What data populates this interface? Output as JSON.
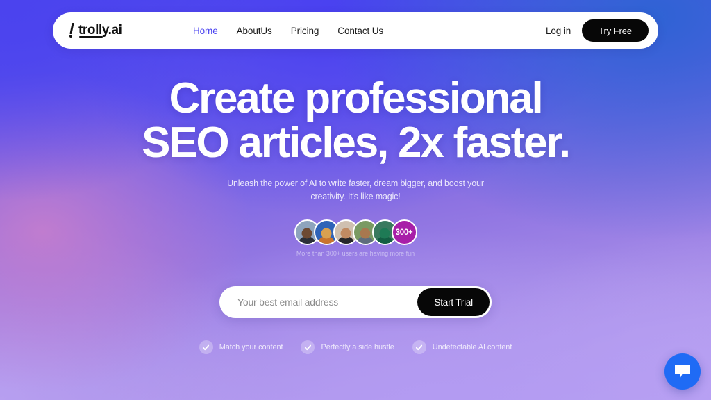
{
  "brand": {
    "logo_text": "trolly.ai",
    "logo_icon": "cart-logo-icon"
  },
  "nav": {
    "links": [
      {
        "label": "Home",
        "active": true
      },
      {
        "label": "AboutUs",
        "active": false
      },
      {
        "label": "Pricing",
        "active": false
      },
      {
        "label": "Contact Us",
        "active": false
      }
    ],
    "login_label": "Log in",
    "cta_label": "Try Free",
    "active_color": "#4a43f0"
  },
  "hero": {
    "headline_line1": "Create professional",
    "headline_line2": "SEO articles, 2x faster.",
    "subheadline": "Unleash the power of AI to write faster, dream bigger, and boost your creativity. It's like magic!"
  },
  "social_proof": {
    "avatars": [
      {
        "name": "user-avatar-1",
        "bg": "#8ea4bd",
        "face": "#6d4a33",
        "body": "#2b2f38"
      },
      {
        "name": "user-avatar-2",
        "bg": "#2e63b8",
        "face": "#d9a050",
        "body": "#c9742e"
      },
      {
        "name": "user-avatar-3",
        "bg": "#cfc0b0",
        "face": "#c08a62",
        "body": "#26262a"
      },
      {
        "name": "user-avatar-4",
        "bg": "#7a9a63",
        "face": "#a8784f",
        "body": "#5e6d7d"
      },
      {
        "name": "user-avatar-5",
        "bg": "#3a7a5e",
        "face": "#1e7a55",
        "body": "#135e43"
      }
    ],
    "count_badge": "300+",
    "count_badge_color": "#a81fa8",
    "caption": "More than 300+ users are having more fun"
  },
  "signup_form": {
    "email_placeholder": "Your best email address",
    "email_value": "",
    "submit_label": "Start Trial"
  },
  "features": [
    {
      "label": "Match your content",
      "icon": "check-icon"
    },
    {
      "label": "Perfectly a side hustle",
      "icon": "check-icon"
    },
    {
      "label": "Undetectable AI content",
      "icon": "check-icon"
    }
  ],
  "chat_widget": {
    "icon": "chat-bubble-icon",
    "color": "#1f6bf5"
  },
  "theme": {
    "background_blue": "#4a43ee",
    "background_purple": "#a472d0",
    "background_lavender": "#b79ff0",
    "button_black": "#070707",
    "white": "#ffffff"
  }
}
